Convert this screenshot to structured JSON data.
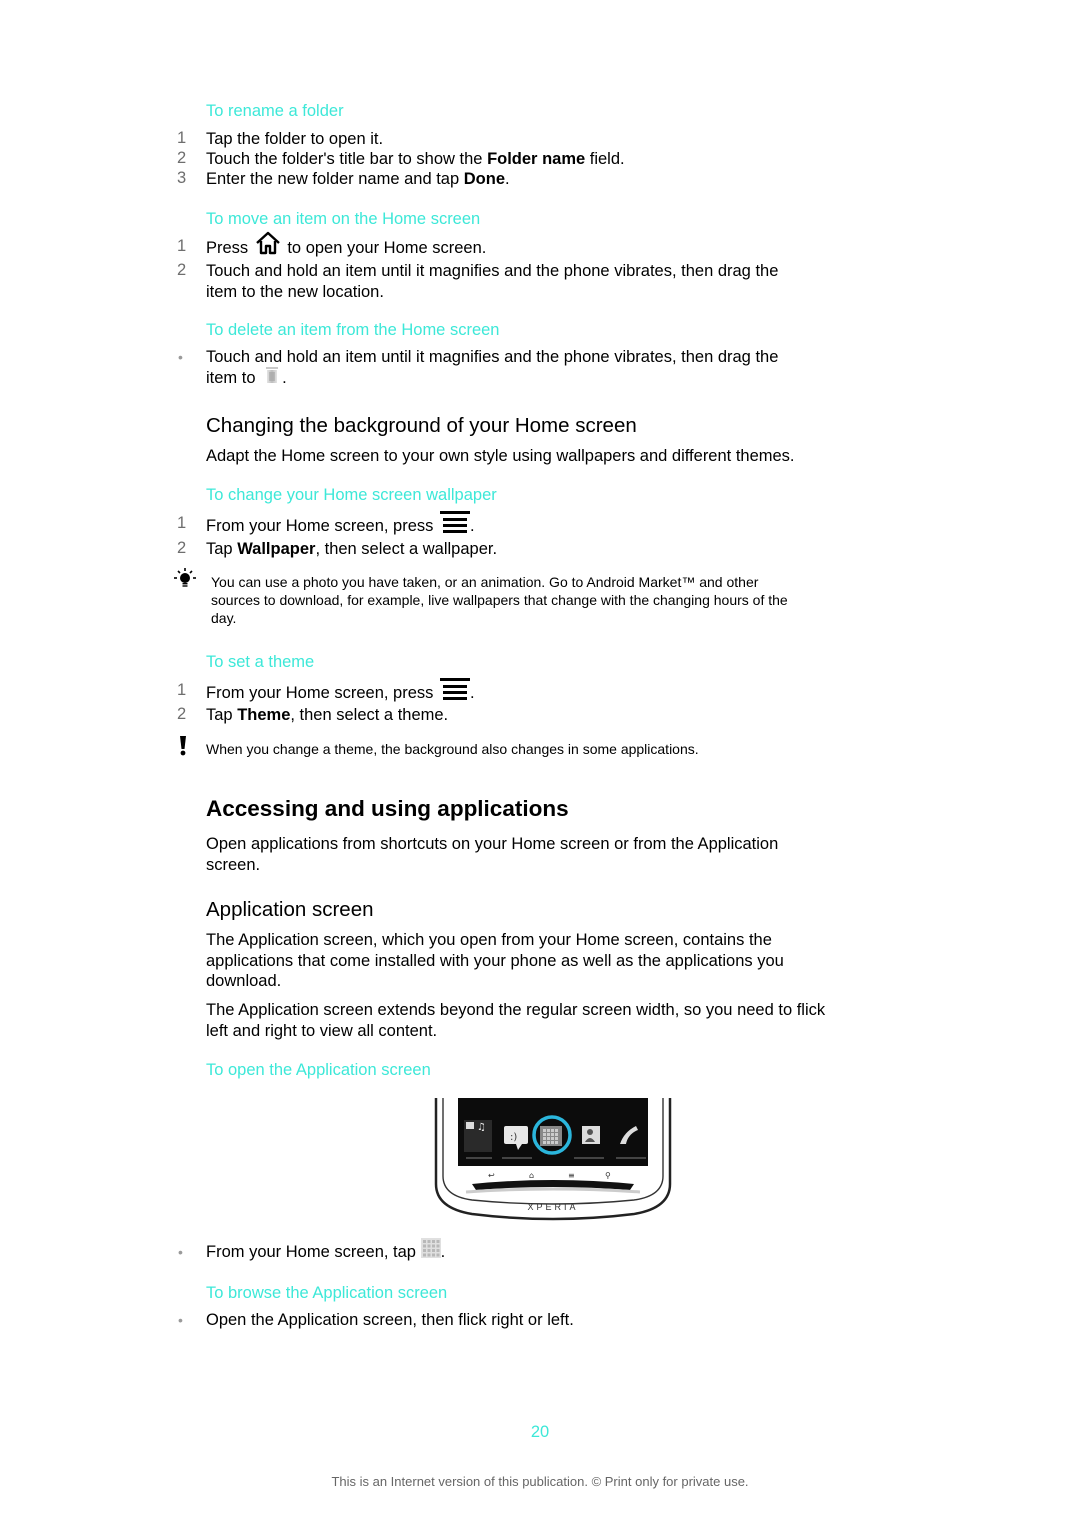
{
  "sections": {
    "rename_folder": {
      "title": "To rename a folder",
      "steps": [
        {
          "num": "1",
          "text": "Tap the folder to open it."
        },
        {
          "num": "2",
          "pre": "Touch the folder's title bar to show the ",
          "bold": "Folder name",
          "post": " field."
        },
        {
          "num": "3",
          "pre": "Enter the new folder name and tap ",
          "bold": "Done",
          "post": "."
        }
      ]
    },
    "move_item": {
      "title": "To move an item on the Home screen",
      "steps": [
        {
          "num": "1",
          "pre": "Press ",
          "post": " to open your Home screen."
        },
        {
          "num": "2",
          "line1": "Touch and hold an item until it magnifies and the phone vibrates, then drag the",
          "line2": "item to the new location."
        }
      ]
    },
    "delete_item": {
      "title": "To delete an item from the Home screen",
      "line1": "Touch and hold an item until it magnifies and the phone vibrates, then drag the",
      "pre2": "item to ",
      "post2": "."
    },
    "background": {
      "heading": "Changing the background of your Home screen",
      "intro": "Adapt the Home screen to your own style using wallpapers and different themes."
    },
    "wallpaper": {
      "title": "To change your Home screen wallpaper",
      "steps": [
        {
          "num": "1",
          "pre": "From your Home screen, press ",
          "post": "."
        },
        {
          "num": "2",
          "pre": "Tap ",
          "bold": "Wallpaper",
          "post": ", then select a wallpaper."
        }
      ],
      "tip": [
        "You can use a photo you have taken, or an animation. Go to Android Market™ and other",
        "sources to download, for example, live wallpapers that change with the changing hours of the",
        "day."
      ]
    },
    "theme": {
      "title": "To set a theme",
      "steps": [
        {
          "num": "1",
          "pre": "From your Home screen, press ",
          "post": "."
        },
        {
          "num": "2",
          "pre": "Tap ",
          "bold": "Theme",
          "post": ", then select a theme."
        }
      ],
      "note": "When you change a theme, the background also changes in some applications."
    },
    "accessing": {
      "heading": "Accessing and using applications",
      "intro": [
        "Open applications from shortcuts on your Home screen or from the Application",
        "screen."
      ]
    },
    "app_screen": {
      "heading": "Application screen",
      "para1": [
        "The Application screen, which you open from your Home screen, contains the",
        "applications that come installed with your phone as well as the applications you",
        "download."
      ],
      "para2": [
        "The Application screen extends beyond the regular screen width, so you need to flick",
        "left and right to view all content."
      ]
    },
    "open_app": {
      "title": "To open the Application screen",
      "phone_brand": "XPERIA",
      "pre": "From your Home screen, tap ",
      "post": "."
    },
    "browse_app": {
      "title": "To browse the Application screen",
      "text": "Open the Application screen, then flick right or left."
    }
  },
  "footer": {
    "page_number": "20",
    "notice": "This is an Internet version of this publication. © Print only for private use."
  },
  "colors": {
    "accent": "#3de8d8",
    "text": "#000000",
    "muted": "#6e6e6e"
  },
  "bullet_char": "•"
}
